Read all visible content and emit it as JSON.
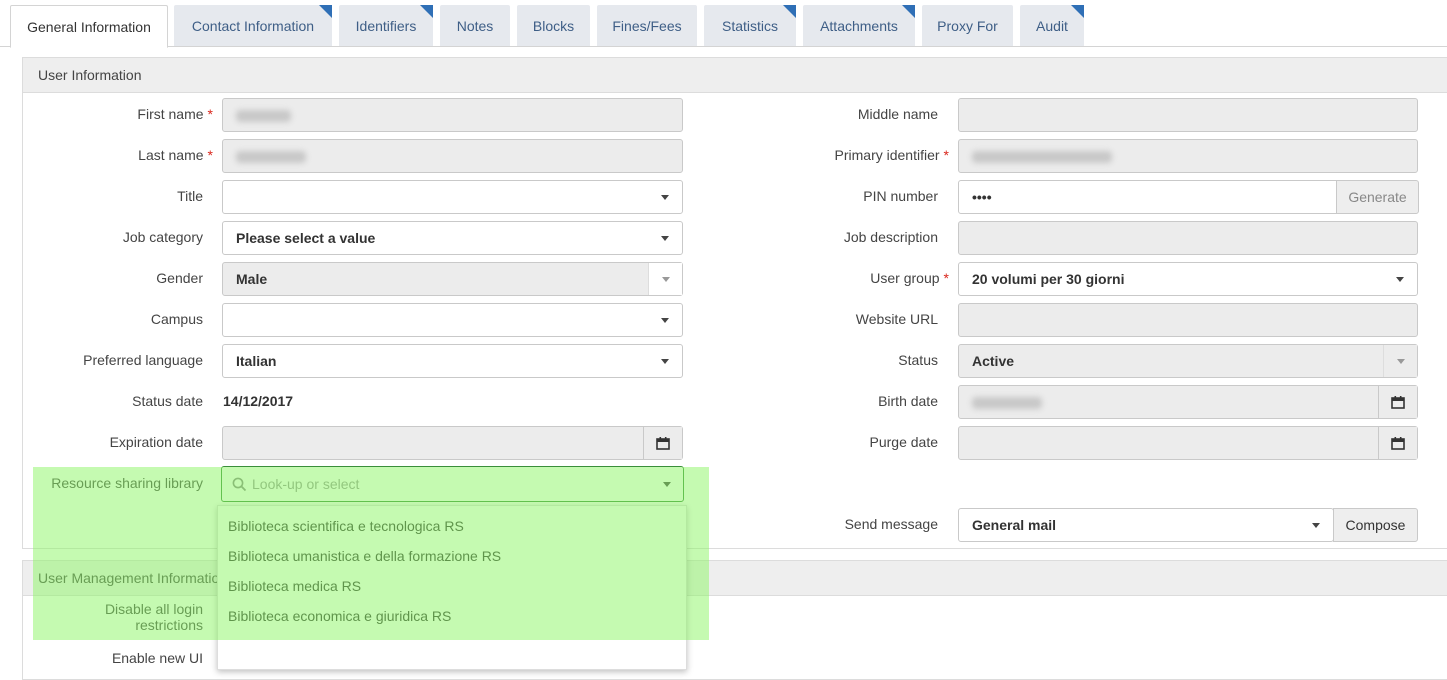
{
  "tabs": [
    {
      "label": "General Information",
      "active": true,
      "flag": false
    },
    {
      "label": "Contact Information",
      "active": false,
      "flag": true
    },
    {
      "label": "Identifiers",
      "active": false,
      "flag": true
    },
    {
      "label": "Notes",
      "active": false,
      "flag": false
    },
    {
      "label": "Blocks",
      "active": false,
      "flag": false
    },
    {
      "label": "Fines/Fees",
      "active": false,
      "flag": false
    },
    {
      "label": "Statistics",
      "active": false,
      "flag": true
    },
    {
      "label": "Attachments",
      "active": false,
      "flag": true
    },
    {
      "label": "Proxy For",
      "active": false,
      "flag": false
    },
    {
      "label": "Audit",
      "active": false,
      "flag": true
    }
  ],
  "user_info": {
    "header": "User Information",
    "first_name_label": "First name",
    "last_name_label": "Last name",
    "title_label": "Title",
    "title_value": "",
    "job_category_label": "Job category",
    "job_category_value": "Please select a value",
    "gender_label": "Gender",
    "gender_value": "Male",
    "campus_label": "Campus",
    "campus_value": "",
    "preferred_language_label": "Preferred language",
    "preferred_language_value": "Italian",
    "status_date_label": "Status date",
    "status_date_value": "14/12/2017",
    "expiration_date_label": "Expiration date",
    "expiration_date_value": "",
    "resource_sharing_label": "Resource sharing library",
    "resource_sharing_placeholder": "Look-up or select",
    "middle_name_label": "Middle name",
    "middle_name_value": "",
    "primary_identifier_label": "Primary identifier",
    "pin_label": "PIN number",
    "pin_value": "••••",
    "generate_label": "Generate",
    "job_description_label": "Job description",
    "job_description_value": "",
    "user_group_label": "User group",
    "user_group_value": "20 volumi per 30 giorni",
    "website_label": "Website URL",
    "website_value": "",
    "status_label": "Status",
    "status_value": "Active",
    "birth_date_label": "Birth date",
    "purge_date_label": "Purge date",
    "purge_date_value": "",
    "send_message_label": "Send message",
    "send_message_value": "General mail",
    "compose_label": "Compose",
    "required_mark": "*"
  },
  "dropdown_options": [
    "Biblioteca scientifica e tecnologica RS",
    "Biblioteca umanistica e della formazione RS",
    "Biblioteca medica RS",
    "Biblioteca economica e giuridica RS"
  ],
  "user_mgmt": {
    "header": "User Management Information",
    "disable_login_label_line1": "Disable all login",
    "disable_login_label_line2": "restrictions",
    "enable_new_ui_label": "Enable new UI"
  },
  "colors": {
    "tab_bg": "#e6e9ee",
    "tab_text": "#3e5e86",
    "tab_flag": "#2f6fb6",
    "highlight": "#8cf564",
    "required": "#d9251b"
  }
}
